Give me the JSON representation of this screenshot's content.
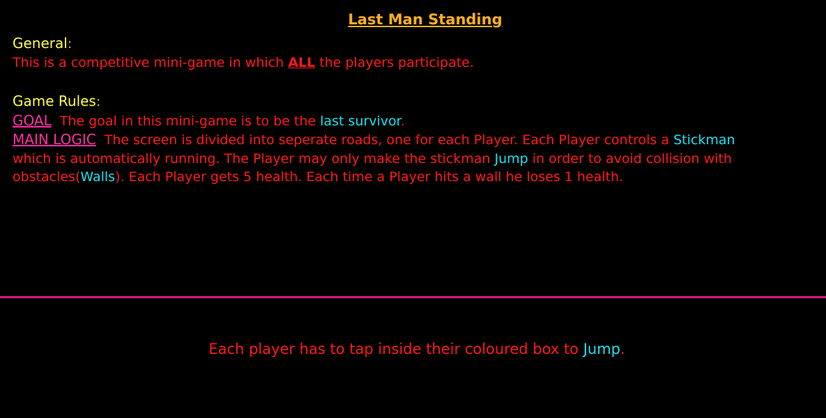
{
  "title": "Last Man Standing",
  "general": {
    "heading": "General",
    "colon": ":",
    "text_before": "This is a competitive mini-game in which ",
    "highlight": "ALL",
    "text_after": " the players participate."
  },
  "rules": {
    "heading": "Game Rules",
    "colon": ":",
    "goal": {
      "label": "GOAL",
      "text_before": "  The goal in this mini-game is to be the ",
      "highlight": "last survivor",
      "text_after": "."
    },
    "main_logic": {
      "label": "MAIN LOGIC",
      "line1_before": "  The screen is divided into seperate roads, one for each Player. Each Player controls a ",
      "line1_highlight": "Stickman",
      "line2_before": "which is automatically running. The Player may only make the stickman ",
      "line2_highlight": "Jump",
      "line2_after": " in order to avoid collision with",
      "line3_before": "obstacles(",
      "line3_highlight": "Walls",
      "line3_after": "). Each Player gets 5 health. Each time a Player hits a wall he loses 1 health."
    }
  },
  "footer": {
    "text_before": "Each player has to tap inside their coloured box to ",
    "highlight": "Jump",
    "text_after": "."
  },
  "colors": {
    "background": "#000000",
    "title": "#ffb020",
    "heading": "#ffff4d",
    "body_text": "#ff1a1a",
    "highlight": "#1ee0ee",
    "label": "#ff2fa5",
    "divider": "#e0137a"
  }
}
